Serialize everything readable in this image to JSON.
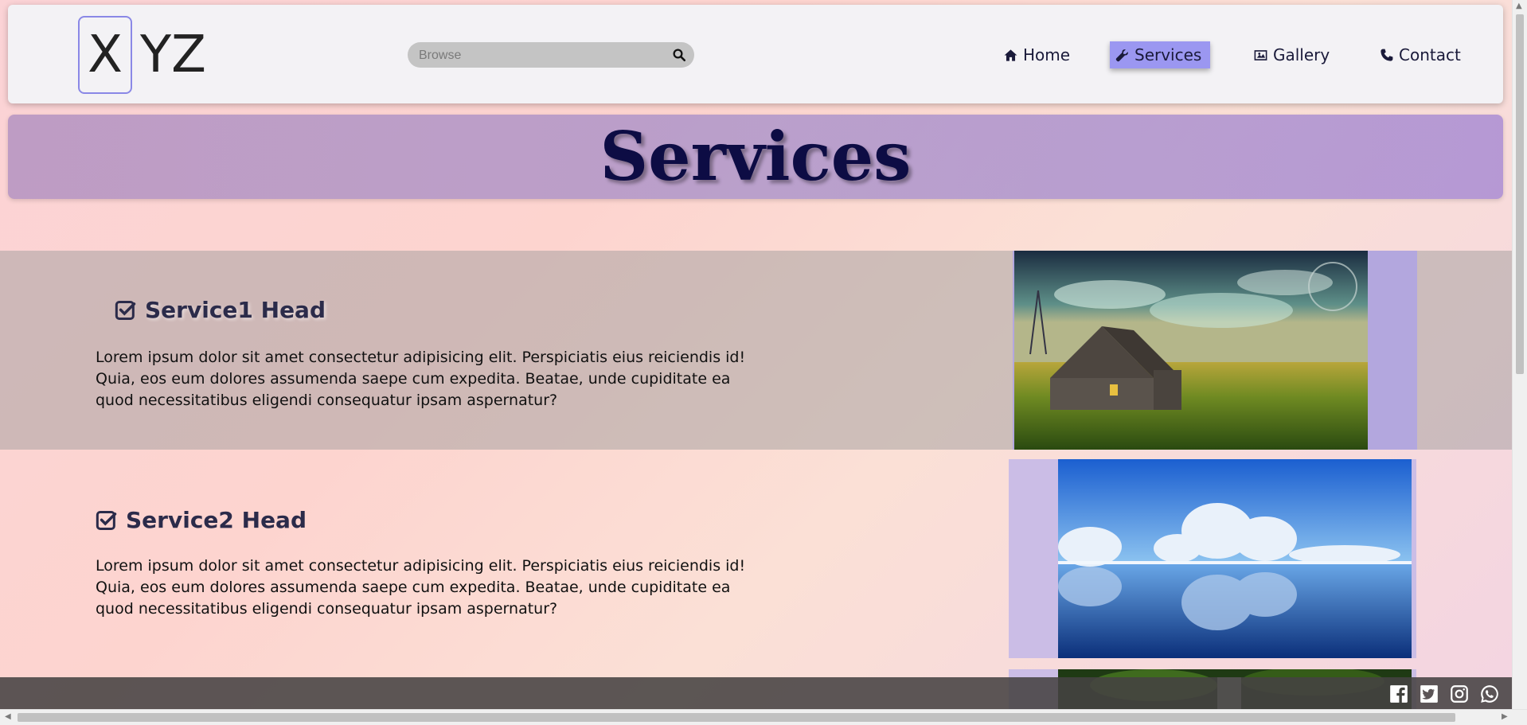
{
  "header": {
    "logo": {
      "first": "X",
      "rest": "YZ"
    },
    "search": {
      "placeholder": "Browse",
      "icon": "search-icon"
    },
    "nav": [
      {
        "label": "Home",
        "icon": "home-icon",
        "active": false
      },
      {
        "label": "Services",
        "icon": "wrench-icon",
        "active": true
      },
      {
        "label": "Gallery",
        "icon": "image-icon",
        "active": false
      },
      {
        "label": "Contact",
        "icon": "phone-icon",
        "active": false
      }
    ]
  },
  "page_title": "Services",
  "services": [
    {
      "head": "Service1 Head",
      "icon": "check-square-icon",
      "text": "Lorem ipsum dolor sit amet consectetur adipisicing elit. Perspiciatis eius reiciendis id! Quia, eos eum dolores assumenda saepe cum expedita. Beatae, unde cupiditate ea quod necessitatibus eligendi consequatur ipsam aspernatur?",
      "image": "farmhouse-landscape-image"
    },
    {
      "head": "Service2 Head",
      "icon": "check-square-icon",
      "text": "Lorem ipsum dolor sit amet consectetur adipisicing elit. Perspiciatis eius reiciendis id! Quia, eos eum dolores assumenda saepe cum expedita. Beatae, unde cupiditate ea quod necessitatibus eligendi consequatur ipsam aspernatur?",
      "image": "snowy-trees-lake-image"
    },
    {
      "image": "waterfall-forest-image"
    }
  ],
  "footer": {
    "social": [
      "facebook-icon",
      "twitter-icon",
      "instagram-icon",
      "whatsapp-icon"
    ]
  },
  "colors": {
    "nav_active": "#9b97f1",
    "title_text": "#0d0c44",
    "footer_bg": "#464242"
  }
}
